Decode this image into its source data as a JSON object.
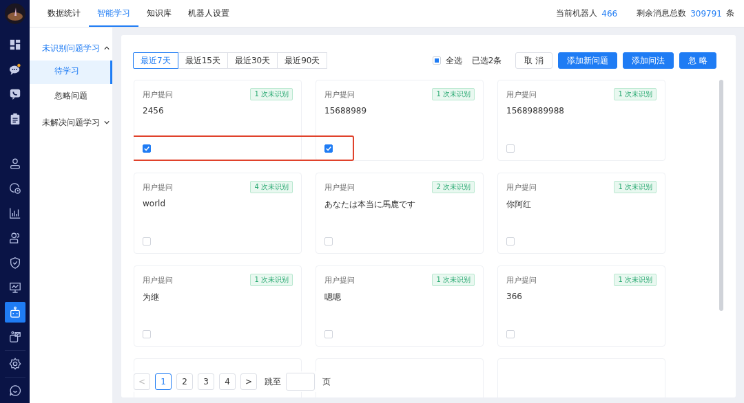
{
  "nav_icons": [
    {
      "selected": false,
      "notification": false
    },
    {
      "selected": false,
      "notification": true
    },
    {
      "selected": false,
      "notification": false
    },
    {
      "selected": false,
      "notification": false
    },
    {
      "selected": false,
      "notification": false
    },
    {
      "selected": false,
      "notification": false
    },
    {
      "selected": false,
      "notification": false
    },
    {
      "selected": false,
      "notification": false
    },
    {
      "selected": false,
      "notification": false
    },
    {
      "selected": false,
      "notification": false
    },
    {
      "selected": true,
      "notification": false
    },
    {
      "selected": false,
      "notification": false
    },
    {
      "selected": false,
      "notification": false
    },
    {
      "selected": false,
      "notification": false
    }
  ],
  "tabs": [
    {
      "label": "数据统计",
      "selected": false
    },
    {
      "label": "智能学习",
      "selected": true
    },
    {
      "label": "知识库",
      "selected": false
    },
    {
      "label": "机器人设置",
      "selected": false
    }
  ],
  "stats": [
    {
      "label": "当前机器人",
      "value": "466"
    },
    {
      "label": "剩余消息总数",
      "value": "309791",
      "unit": "条"
    }
  ],
  "menu": [
    {
      "label": "未识别问题学习",
      "expanded": true,
      "children": [
        {
          "label": "待学习",
          "selected": true
        },
        {
          "label": "忽略问题",
          "selected": false
        }
      ]
    },
    {
      "label": "未解决问题学习",
      "expanded": false
    }
  ],
  "ranges": [
    {
      "label": "最近7天",
      "selected": true
    },
    {
      "label": "最近15天",
      "selected": false
    },
    {
      "label": "最近30天",
      "selected": false
    },
    {
      "label": "最近90天",
      "selected": false
    }
  ],
  "select_all": {
    "label": "全选",
    "indeterminate": true
  },
  "selected_count": "已选2条",
  "buttons": [
    {
      "label": "取 消",
      "kind": "plain"
    },
    {
      "label": "添加新问题",
      "kind": "primary"
    },
    {
      "label": "添加问法",
      "kind": "primary"
    },
    {
      "label": "忽 略",
      "kind": "primary"
    }
  ],
  "cards": [
    {
      "label": "用户提问",
      "count": "1 次未识别",
      "text": "2456",
      "checked": true
    },
    {
      "label": "用户提问",
      "count": "1 次未识别",
      "text": "15688989",
      "checked": true
    },
    {
      "label": "用户提问",
      "count": "1 次未识别",
      "text": "15689889988",
      "checked": false
    },
    {
      "label": "用户提问",
      "count": "4 次未识别",
      "text": "world",
      "checked": false
    },
    {
      "label": "用户提问",
      "count": "2 次未识别",
      "text": "あなたは本当に馬鹿です",
      "checked": false
    },
    {
      "label": "用户提问",
      "count": "1 次未识别",
      "text": "你阿红",
      "checked": false
    },
    {
      "label": "用户提问",
      "count": "1 次未识别",
      "text": "为继",
      "checked": false
    },
    {
      "label": "用户提问",
      "count": "1 次未识别",
      "text": "嗯嗯",
      "checked": false
    },
    {
      "label": "用户提问",
      "count": "1 次未识别",
      "text": "366",
      "checked": false
    }
  ],
  "pagination": {
    "pages": [
      {
        "label": "1",
        "selected": true
      },
      {
        "label": "2",
        "selected": false
      },
      {
        "label": "3",
        "selected": false
      },
      {
        "label": "4",
        "selected": false
      }
    ],
    "prev": "<",
    "next": ">",
    "jump_label": "跳至",
    "page_unit": "页"
  }
}
